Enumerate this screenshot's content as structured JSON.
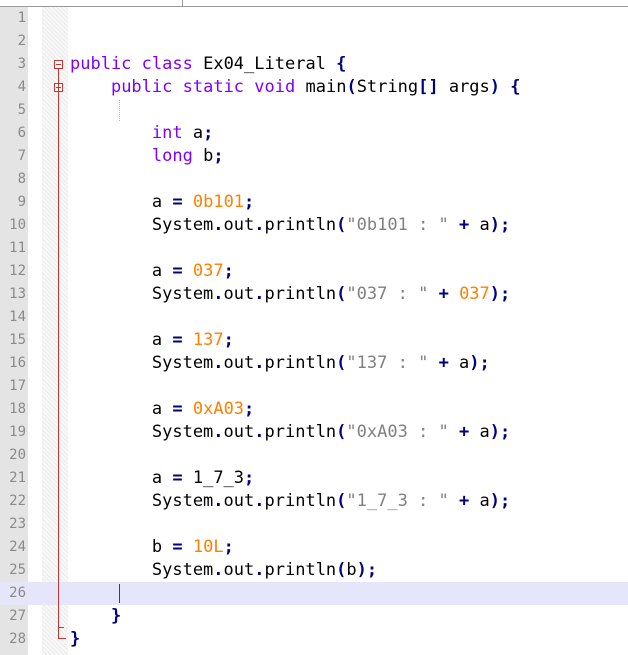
{
  "editor": {
    "current_line": 26,
    "lines": [
      {
        "n": "1",
        "tokens": []
      },
      {
        "n": "2",
        "tokens": []
      },
      {
        "n": "3",
        "tokens": [
          {
            "t": "public",
            "c": "kw"
          },
          {
            "t": " "
          },
          {
            "t": "class",
            "c": "kw"
          },
          {
            "t": " Ex04_Literal "
          },
          {
            "t": "{",
            "c": "op"
          }
        ]
      },
      {
        "n": "4",
        "tokens": [
          {
            "t": "    "
          },
          {
            "t": "public",
            "c": "kw"
          },
          {
            "t": " "
          },
          {
            "t": "static",
            "c": "kw"
          },
          {
            "t": " "
          },
          {
            "t": "void",
            "c": "type"
          },
          {
            "t": " main"
          },
          {
            "t": "(",
            "c": "op"
          },
          {
            "t": "String"
          },
          {
            "t": "[]",
            "c": "op"
          },
          {
            "t": " args"
          },
          {
            "t": ")",
            "c": "op"
          },
          {
            "t": " "
          },
          {
            "t": "{",
            "c": "op"
          }
        ]
      },
      {
        "n": "5",
        "tokens": []
      },
      {
        "n": "6",
        "tokens": [
          {
            "t": "        "
          },
          {
            "t": "int",
            "c": "type"
          },
          {
            "t": " a"
          },
          {
            "t": ";",
            "c": "op"
          }
        ]
      },
      {
        "n": "7",
        "tokens": [
          {
            "t": "        "
          },
          {
            "t": "long",
            "c": "type"
          },
          {
            "t": " b"
          },
          {
            "t": ";",
            "c": "op"
          }
        ]
      },
      {
        "n": "8",
        "tokens": []
      },
      {
        "n": "9",
        "tokens": [
          {
            "t": "        a "
          },
          {
            "t": "=",
            "c": "op"
          },
          {
            "t": " "
          },
          {
            "t": "0b101",
            "c": "num"
          },
          {
            "t": ";",
            "c": "op"
          }
        ]
      },
      {
        "n": "10",
        "tokens": [
          {
            "t": "        System"
          },
          {
            "t": ".",
            "c": "op"
          },
          {
            "t": "out"
          },
          {
            "t": ".",
            "c": "op"
          },
          {
            "t": "println"
          },
          {
            "t": "(",
            "c": "op"
          },
          {
            "t": "\"0b101 : \"",
            "c": "str"
          },
          {
            "t": " "
          },
          {
            "t": "+",
            "c": "op"
          },
          {
            "t": " a"
          },
          {
            "t": ");",
            "c": "op"
          }
        ]
      },
      {
        "n": "11",
        "tokens": []
      },
      {
        "n": "12",
        "tokens": [
          {
            "t": "        a "
          },
          {
            "t": "=",
            "c": "op"
          },
          {
            "t": " "
          },
          {
            "t": "037",
            "c": "num"
          },
          {
            "t": ";",
            "c": "op"
          }
        ]
      },
      {
        "n": "13",
        "tokens": [
          {
            "t": "        System"
          },
          {
            "t": ".",
            "c": "op"
          },
          {
            "t": "out"
          },
          {
            "t": ".",
            "c": "op"
          },
          {
            "t": "println"
          },
          {
            "t": "(",
            "c": "op"
          },
          {
            "t": "\"037 : \"",
            "c": "str"
          },
          {
            "t": " "
          },
          {
            "t": "+",
            "c": "op"
          },
          {
            "t": " "
          },
          {
            "t": "037",
            "c": "num"
          },
          {
            "t": ");",
            "c": "op"
          }
        ]
      },
      {
        "n": "14",
        "tokens": []
      },
      {
        "n": "15",
        "tokens": [
          {
            "t": "        a "
          },
          {
            "t": "=",
            "c": "op"
          },
          {
            "t": " "
          },
          {
            "t": "137",
            "c": "num"
          },
          {
            "t": ";",
            "c": "op"
          }
        ]
      },
      {
        "n": "16",
        "tokens": [
          {
            "t": "        System"
          },
          {
            "t": ".",
            "c": "op"
          },
          {
            "t": "out"
          },
          {
            "t": ".",
            "c": "op"
          },
          {
            "t": "println"
          },
          {
            "t": "(",
            "c": "op"
          },
          {
            "t": "\"137 : \"",
            "c": "str"
          },
          {
            "t": " "
          },
          {
            "t": "+",
            "c": "op"
          },
          {
            "t": " a"
          },
          {
            "t": ");",
            "c": "op"
          }
        ]
      },
      {
        "n": "17",
        "tokens": []
      },
      {
        "n": "18",
        "tokens": [
          {
            "t": "        a "
          },
          {
            "t": "=",
            "c": "op"
          },
          {
            "t": " "
          },
          {
            "t": "0xA03",
            "c": "num"
          },
          {
            "t": ";",
            "c": "op"
          }
        ]
      },
      {
        "n": "19",
        "tokens": [
          {
            "t": "        System"
          },
          {
            "t": ".",
            "c": "op"
          },
          {
            "t": "out"
          },
          {
            "t": ".",
            "c": "op"
          },
          {
            "t": "println"
          },
          {
            "t": "(",
            "c": "op"
          },
          {
            "t": "\"0xA03 : \"",
            "c": "str"
          },
          {
            "t": " "
          },
          {
            "t": "+",
            "c": "op"
          },
          {
            "t": " a"
          },
          {
            "t": ");",
            "c": "op"
          }
        ]
      },
      {
        "n": "20",
        "tokens": []
      },
      {
        "n": "21",
        "tokens": [
          {
            "t": "        a "
          },
          {
            "t": "=",
            "c": "op"
          },
          {
            "t": " 1_7_3"
          },
          {
            "t": ";",
            "c": "op"
          }
        ]
      },
      {
        "n": "22",
        "tokens": [
          {
            "t": "        System"
          },
          {
            "t": ".",
            "c": "op"
          },
          {
            "t": "out"
          },
          {
            "t": ".",
            "c": "op"
          },
          {
            "t": "println"
          },
          {
            "t": "(",
            "c": "op"
          },
          {
            "t": "\"1_7_3 : \"",
            "c": "str"
          },
          {
            "t": " "
          },
          {
            "t": "+",
            "c": "op"
          },
          {
            "t": " a"
          },
          {
            "t": ");",
            "c": "op"
          }
        ]
      },
      {
        "n": "23",
        "tokens": []
      },
      {
        "n": "24",
        "tokens": [
          {
            "t": "        b "
          },
          {
            "t": "=",
            "c": "op"
          },
          {
            "t": " "
          },
          {
            "t": "10L",
            "c": "num"
          },
          {
            "t": ";",
            "c": "op"
          }
        ]
      },
      {
        "n": "25",
        "tokens": [
          {
            "t": "        System"
          },
          {
            "t": ".",
            "c": "op"
          },
          {
            "t": "out"
          },
          {
            "t": ".",
            "c": "op"
          },
          {
            "t": "println"
          },
          {
            "t": "(",
            "c": "op"
          },
          {
            "t": "b"
          },
          {
            "t": ");",
            "c": "op"
          }
        ]
      },
      {
        "n": "26",
        "tokens": []
      },
      {
        "n": "27",
        "tokens": [
          {
            "t": "    "
          },
          {
            "t": "}",
            "c": "op"
          }
        ]
      },
      {
        "n": "28",
        "tokens": [
          {
            "t": "}",
            "c": "op"
          }
        ]
      }
    ]
  },
  "colors": {
    "keyword": "#8000ff",
    "number": "#ff8000",
    "string": "#808080",
    "operator": "#000080",
    "current_line_bg": "#e6e6fa",
    "fold_marker": "#cc3333"
  }
}
